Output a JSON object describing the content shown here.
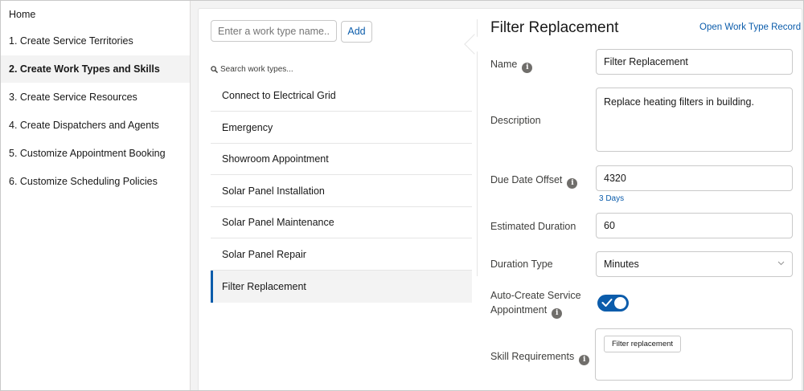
{
  "nav": {
    "items": [
      {
        "label": "Home",
        "active": false
      },
      {
        "label": "1. Create Service Territories",
        "active": false
      },
      {
        "label": "2. Create Work Types and Skills",
        "active": true
      },
      {
        "label": "3. Create Service Resources",
        "active": false
      },
      {
        "label": "4. Create Dispatchers and Agents",
        "active": false
      },
      {
        "label": "5. Customize Appointment Booking",
        "active": false
      },
      {
        "label": "6. Customize Scheduling Policies",
        "active": false
      }
    ]
  },
  "worktypes": {
    "name_placeholder": "Enter a work type name...",
    "add_label": "Add",
    "search_placeholder": "Search work types...",
    "items": [
      {
        "label": "Connect to Electrical Grid"
      },
      {
        "label": "Emergency"
      },
      {
        "label": "Showroom Appointment"
      },
      {
        "label": "Solar Panel Installation"
      },
      {
        "label": "Solar Panel Maintenance"
      },
      {
        "label": "Solar Panel Repair"
      },
      {
        "label": "Filter Replacement",
        "selected": true
      }
    ]
  },
  "detail": {
    "title": "Filter Replacement",
    "open_record_label": "Open Work Type Record",
    "name_label": "Name",
    "name_value": "Filter Replacement",
    "description_label": "Description",
    "description_value": "Replace heating filters in building.",
    "due_date_offset_label": "Due Date Offset",
    "due_date_offset_value": "4320",
    "due_date_offset_helper": "3 Days",
    "estimated_duration_label": "Estimated Duration",
    "estimated_duration_value": "60",
    "duration_type_label": "Duration Type",
    "duration_type_value": "Minutes",
    "auto_create_label_line1": "Auto-Create Service",
    "auto_create_label_line2": "Appointment",
    "auto_create_enabled": true,
    "skill_requirements_label": "Skill Requirements",
    "skills": [
      "Filter replacement"
    ]
  },
  "colors": {
    "brand": "#0b5cab",
    "page_bg": "#f3f3f3",
    "border": "#c9c9c9",
    "info_icon": "#706e6b"
  },
  "icons": [
    "search-icon",
    "info-icon",
    "chevron-down-icon",
    "check-icon"
  ]
}
